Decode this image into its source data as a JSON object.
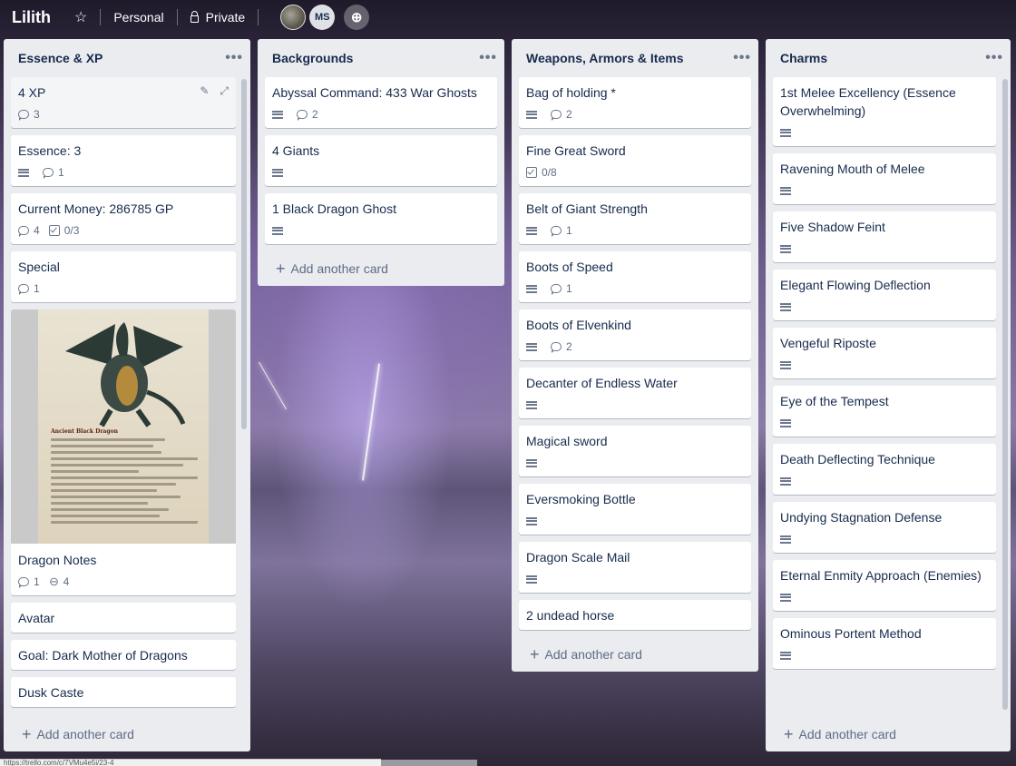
{
  "header": {
    "title": "Lilith",
    "team": "Personal",
    "visibility": "Private",
    "members": [
      {
        "initials": ""
      },
      {
        "initials": "MS"
      }
    ],
    "icons": {
      "star": "star-icon",
      "lock": "lock-icon",
      "add_member": "add-member-icon"
    }
  },
  "lists": [
    {
      "title": "Essence & XP",
      "add_label": "Add another card",
      "cards": [
        {
          "title": "4 XP",
          "badges": {
            "comments": "3"
          }
        },
        {
          "title": "Essence: 3",
          "badges": {
            "comments": "1"
          }
        },
        {
          "title": "Current Money: 286785 GP",
          "badges": {
            "comments": "4",
            "checklist": "0/3"
          }
        },
        {
          "title": "Special",
          "badges": {
            "comments": "1"
          }
        },
        {
          "title": "Dragon Notes",
          "cover_title": "Ancient Black Dragon",
          "badges": {
            "comments": "1",
            "attachments": "4"
          }
        },
        {
          "title": "Avatar"
        },
        {
          "title": "Goal: Dark Mother of Dragons"
        },
        {
          "title": "Dusk Caste"
        }
      ]
    },
    {
      "title": "Backgrounds",
      "add_label": "Add another card",
      "cards": [
        {
          "title": "Abyssal Command: 433 War Ghosts",
          "badges": {
            "comments": "2"
          }
        },
        {
          "title": "4 Giants"
        },
        {
          "title": "1 Black Dragon Ghost"
        }
      ]
    },
    {
      "title": "Weapons, Armors & Items",
      "add_label": "Add another card",
      "cards": [
        {
          "title": "Bag of holding *",
          "badges": {
            "comments": "2"
          }
        },
        {
          "title": "Fine Great Sword",
          "badges": {
            "checklist": "0/8"
          }
        },
        {
          "title": "Belt of Giant Strength",
          "badges": {
            "comments": "1"
          }
        },
        {
          "title": "Boots of Speed",
          "badges": {
            "comments": "1"
          }
        },
        {
          "title": "Boots of Elvenkind",
          "badges": {
            "comments": "2"
          }
        },
        {
          "title": "Decanter of Endless Water"
        },
        {
          "title": "Magical sword"
        },
        {
          "title": "Eversmoking Bottle"
        },
        {
          "title": "Dragon Scale Mail"
        },
        {
          "title": "2 undead horse"
        }
      ]
    },
    {
      "title": "Charms",
      "add_label": "Add another card",
      "cards": [
        {
          "title": "1st Melee Excellency (Essence Overwhelming)"
        },
        {
          "title": "Ravening Mouth of Melee"
        },
        {
          "title": "Five Shadow Feint"
        },
        {
          "title": "Elegant Flowing Deflection"
        },
        {
          "title": "Vengeful Riposte"
        },
        {
          "title": "Eye of the Tempest"
        },
        {
          "title": "Death Deflecting Technique"
        },
        {
          "title": "Undying Stagnation Defense"
        },
        {
          "title": "Eternal Enmity Approach (Enemies)"
        },
        {
          "title": "Ominous Portent Method"
        }
      ]
    }
  ],
  "status_url": "https://trello.com/c/7VMu4e5i/23-4"
}
